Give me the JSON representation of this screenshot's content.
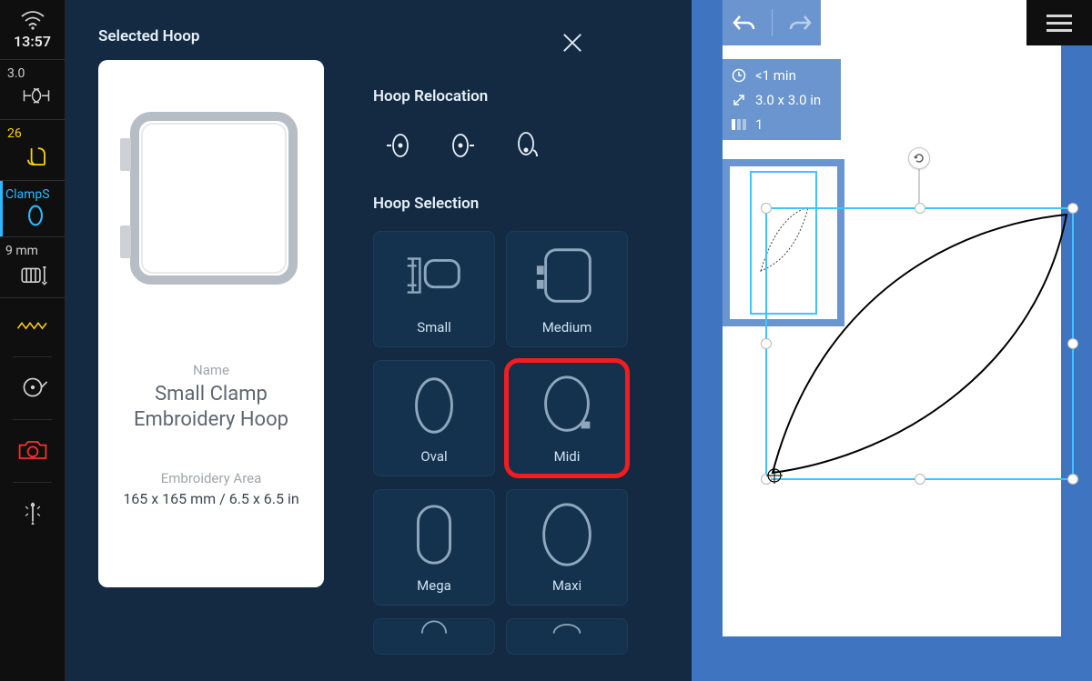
{
  "status": {
    "time": "13:57",
    "version": "3.0",
    "stitch_count": "26",
    "hoop_code": "ClampS",
    "thickness": "9 mm"
  },
  "panel": {
    "selected_title": "Selected Hoop",
    "details": {
      "name_label": "Name",
      "name_value": "Small Clamp Embroidery Hoop",
      "area_label": "Embroidery Area",
      "area_value": "165 x 165 mm / 6.5 x 6.5 in"
    },
    "reloc_title": "Hoop Relocation",
    "selection_title": "Hoop Selection",
    "hoops": [
      "Small",
      "Medium",
      "Oval",
      "Midi",
      "Mega",
      "Maxi"
    ],
    "highlight_index": 3
  },
  "editor": {
    "info": {
      "time_est": "<1 min",
      "size": "3.0 x 3.0 in",
      "colors": "1"
    }
  }
}
